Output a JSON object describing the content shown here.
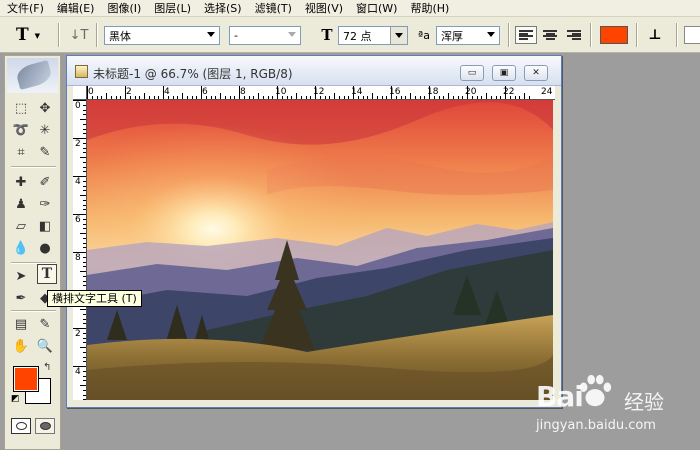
{
  "menu": [
    "文件(F)",
    "编辑(E)",
    "图像(I)",
    "图层(L)",
    "选择(S)",
    "滤镜(T)",
    "视图(V)",
    "窗口(W)",
    "帮助(H)"
  ],
  "options": {
    "tool_glyph": "T",
    "orientation_glyph": "↓T",
    "font_family": "黑体",
    "font_style": "-",
    "size_glyph": "T",
    "font_size": "72 点",
    "aa_glyph": "ªa",
    "aa_mode": "浑厚",
    "text_color": "#ff4400",
    "warp_glyph": "⊥"
  },
  "document": {
    "title": "未标题-1 @ 66.7% (图层 1, RGB/8)",
    "btn_minimize": "▭",
    "btn_restore": "▣",
    "btn_close": "✕",
    "ruler_h_labels": [
      "0",
      "2",
      "4",
      "6",
      "8",
      "10",
      "12",
      "14",
      "16",
      "18",
      "20",
      "22",
      "24"
    ],
    "ruler_v_labels": [
      "0",
      "2",
      "4",
      "6",
      "8",
      "0",
      "2",
      "4"
    ]
  },
  "toolbox": {
    "tooltip": "横排文字工具 (T)",
    "foreground_color": "#ff4400",
    "background_color": "#ffffff"
  },
  "watermark": {
    "logo": "Bai",
    "logo_suffix": "经验",
    "url": "jingyan.baidu.com"
  }
}
